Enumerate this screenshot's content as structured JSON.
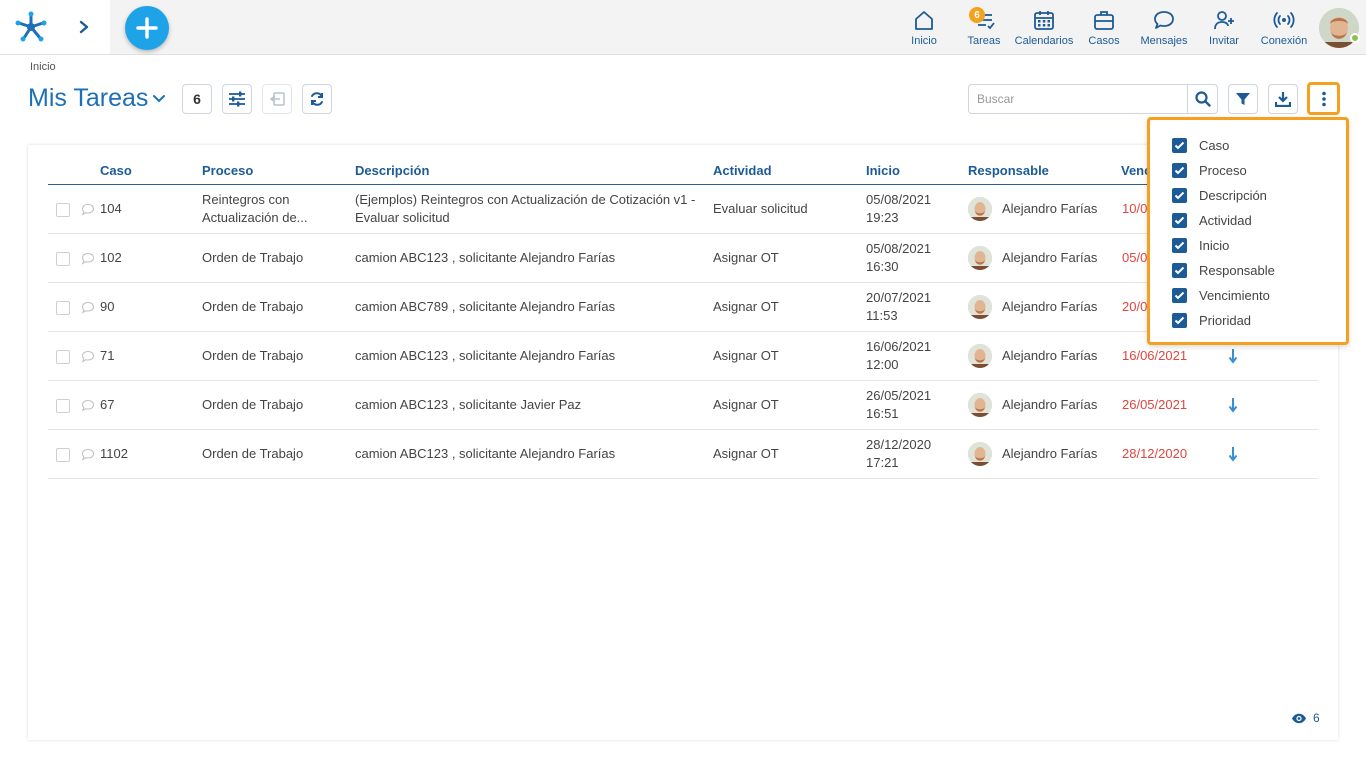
{
  "topbar": {
    "nav": [
      {
        "label": "Inicio",
        "icon": "home-icon"
      },
      {
        "label": "Tareas",
        "icon": "tasks-icon",
        "badge": "6"
      },
      {
        "label": "Calendarios",
        "icon": "calendar-icon"
      },
      {
        "label": "Casos",
        "icon": "briefcase-icon"
      },
      {
        "label": "Mensajes",
        "icon": "message-icon"
      },
      {
        "label": "Invitar",
        "icon": "invite-user-icon"
      },
      {
        "label": "Conexión",
        "icon": "connection-icon"
      }
    ],
    "accent": "#1fa3e8",
    "nav_color": "#1d5b96",
    "badge_color": "#f4a21b",
    "online_status": "online"
  },
  "breadcrumb": "Inicio",
  "page": {
    "title": "Mis Tareas",
    "count": "6",
    "search_placeholder": "Buscar"
  },
  "table": {
    "columns": [
      "Caso",
      "Proceso",
      "Descripción",
      "Actividad",
      "Inicio",
      "Responsable",
      "Venc"
    ],
    "rows": [
      {
        "caso": "104",
        "proceso": "Reintegros con",
        "proceso2": "Actualización de...",
        "descripcion": "(Ejemplos) Reintegros con Actualización de Cotización v1 -",
        "descripcion2": "Evaluar solicitud",
        "actividad": "Evaluar solicitud",
        "inicio_fecha": "05/08/2021",
        "inicio_hora": "19:23",
        "responsable": "Alejandro Farías",
        "vencimiento": "10/0"
      },
      {
        "caso": "102",
        "proceso": "Orden de Trabajo",
        "descripcion": "camion ABC123 , solicitante Alejandro Farías",
        "actividad": "Asignar OT",
        "inicio_fecha": "05/08/2021",
        "inicio_hora": "16:30",
        "responsable": "Alejandro Farías",
        "vencimiento": "05/0"
      },
      {
        "caso": "90",
        "proceso": "Orden de Trabajo",
        "descripcion": "camion ABC789 , solicitante Alejandro Farías",
        "actividad": "Asignar OT",
        "inicio_fecha": "20/07/2021",
        "inicio_hora": "11:53",
        "responsable": "Alejandro Farías",
        "vencimiento": "20/0"
      },
      {
        "caso": "71",
        "proceso": "Orden de Trabajo",
        "descripcion": "camion ABC123 , solicitante Alejandro Farías",
        "actividad": "Asignar OT",
        "inicio_fecha": "16/06/2021",
        "inicio_hora": "12:00",
        "responsable": "Alejandro Farías",
        "vencimiento": "16/06/2021"
      },
      {
        "caso": "67",
        "proceso": "Orden de Trabajo",
        "descripcion": "camion ABC123 , solicitante Javier Paz",
        "actividad": "Asignar OT",
        "inicio_fecha": "26/05/2021",
        "inicio_hora": "16:51",
        "responsable": "Alejandro Farías",
        "vencimiento": "26/05/2021"
      },
      {
        "caso": "1102",
        "proceso": "Orden de Trabajo",
        "descripcion": "camion ABC123 , solicitante Alejandro Farías",
        "actividad": "Asignar OT",
        "inicio_fecha": "28/12/2020",
        "inicio_hora": "17:21",
        "responsable": "Alejandro Farías",
        "vencimiento": "28/12/2020"
      }
    ]
  },
  "column_menu": {
    "items": [
      {
        "label": "Caso",
        "checked": true
      },
      {
        "label": "Proceso",
        "checked": true
      },
      {
        "label": "Descripción",
        "checked": true
      },
      {
        "label": "Actividad",
        "checked": true
      },
      {
        "label": "Inicio",
        "checked": true
      },
      {
        "label": "Responsable",
        "checked": true
      },
      {
        "label": "Vencimiento",
        "checked": true
      },
      {
        "label": "Prioridad",
        "checked": true
      }
    ],
    "highlight_color": "#f5a020"
  },
  "footer": {
    "visible_count": "6"
  }
}
